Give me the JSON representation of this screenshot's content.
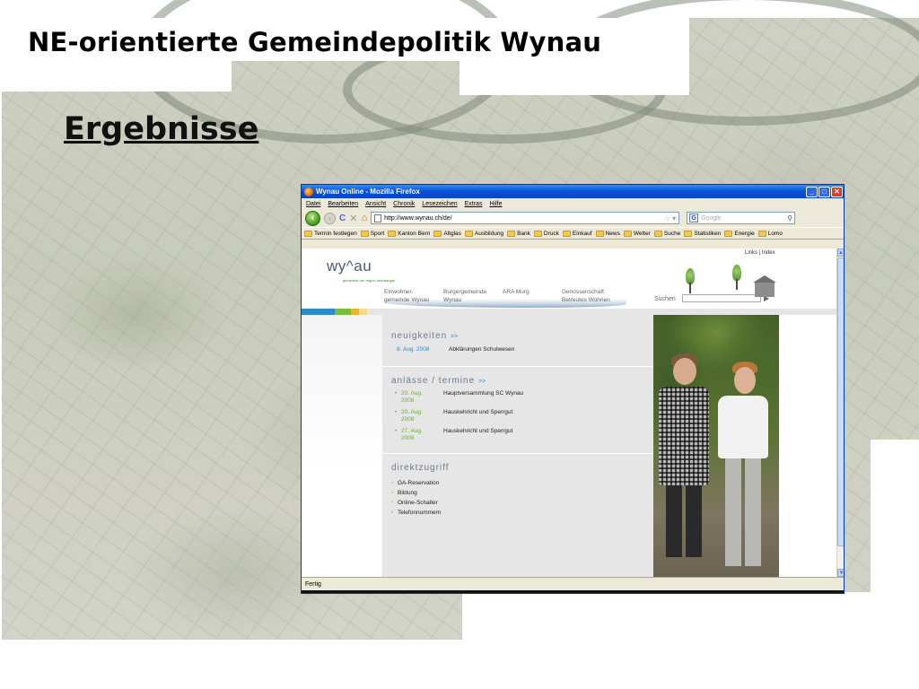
{
  "slide": {
    "title": "NE-orientierte Gemeindepolitik Wynau",
    "subtitle": "Ergebnisse"
  },
  "browser": {
    "window_title": "Wynau Online - Mozilla Firefox",
    "menu": [
      "Datei",
      "Bearbeiten",
      "Ansicht",
      "Chronik",
      "Lesezeichen",
      "Extras",
      "Hilfe"
    ],
    "url": "http://www.wynau.ch/de/",
    "search_placeholder": "Google",
    "bookmarks": [
      "Termin festlegen",
      "Sport",
      "Kanton Bern",
      "Altglas",
      "Ausbildung",
      "Bank",
      "Druck",
      "Einkauf",
      "News",
      "Wetter",
      "Suche",
      "Statistiken",
      "Energie",
      "Lomo"
    ],
    "status": "Fertig"
  },
  "site": {
    "logo": "wy^au",
    "logo_sub": "gemeinde der region oberaargau",
    "top_links": "Links | Index",
    "nav": [
      {
        "line1": "Einwohner-",
        "line2": "gemeinde Wynau"
      },
      {
        "line1": "Burgergemeinde",
        "line2": "Wynau"
      },
      {
        "line1": "ARA Murg",
        "line2": ""
      },
      {
        "line1": "Genossenschaft",
        "line2": "Betreutes Wohnen"
      }
    ],
    "search_label": "Suchen",
    "news": {
      "heading": "neuigkeiten",
      "more": ">>",
      "items": [
        {
          "date": "8. Aug. 2008",
          "text": "Abklärungen Schulwesen"
        }
      ]
    },
    "events": {
      "heading": "anlässe / termine",
      "more": ">>",
      "items": [
        {
          "date_line1": "20. Aug.",
          "date_line2": "2008",
          "text": "Hauptversammlung SC Wynau"
        },
        {
          "date_line1": "20. Aug.",
          "date_line2": "2008",
          "text": "Hauskehricht und Sperrgut"
        },
        {
          "date_line1": "27. Aug.",
          "date_line2": "2008",
          "text": "Hauskehricht und Sperrgut"
        }
      ]
    },
    "direct": {
      "heading": "direktzugriff",
      "items": [
        "GA-Reservation",
        "Bildung",
        "Online-Schalter",
        "Telefonnummern"
      ]
    }
  },
  "colors": {
    "titlebar": "#0a55d8",
    "site_accent_blue": "#2a8bd0",
    "site_accent_green": "#6cae2e",
    "site_accent_yellow": "#f0b428"
  }
}
